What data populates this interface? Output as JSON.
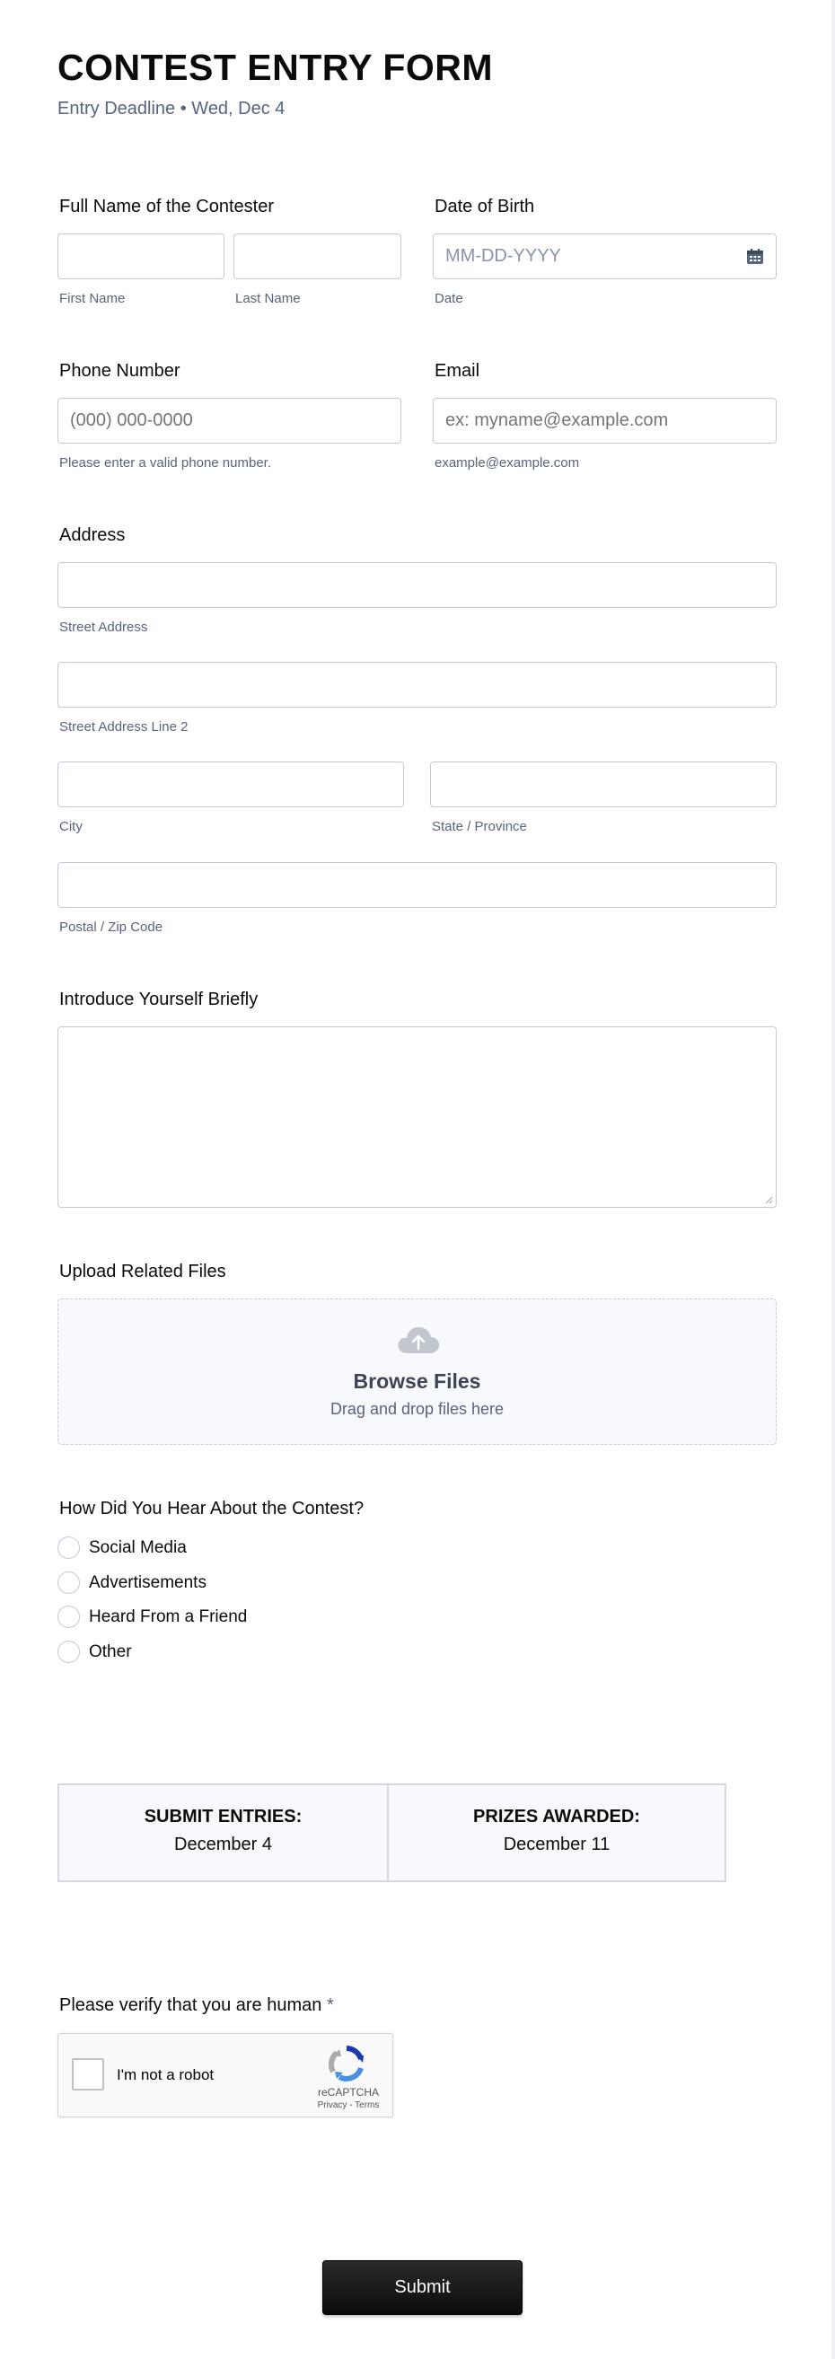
{
  "form": {
    "title": "CONTEST ENTRY FORM",
    "subtitle": "Entry Deadline • Wed, Dec 4"
  },
  "full_name": {
    "label": "Full Name of the Contester",
    "first_sublabel": "First Name",
    "last_sublabel": "Last Name",
    "first_value": "",
    "last_value": ""
  },
  "dob": {
    "label": "Date of Birth",
    "placeholder": "MM-DD-YYYY",
    "sublabel": "Date",
    "icon": "calendar-icon"
  },
  "phone": {
    "label": "Phone Number",
    "placeholder": "(000) 000-0000",
    "sublabel": "Please enter a valid phone number."
  },
  "email": {
    "label": "Email",
    "placeholder": "ex: myname@example.com",
    "sublabel": "example@example.com"
  },
  "address": {
    "label": "Address",
    "street_sublabel": "Street Address",
    "street2_sublabel": "Street Address Line 2",
    "city_sublabel": "City",
    "state_sublabel": "State / Province",
    "postal_sublabel": "Postal / Zip Code"
  },
  "intro": {
    "label": "Introduce Yourself Briefly"
  },
  "upload": {
    "label": "Upload Related Files",
    "browse": "Browse Files",
    "hint": "Drag and drop files here",
    "icon": "cloud-upload-icon"
  },
  "hear": {
    "label": "How Did You Hear About the Contest?",
    "options": [
      "Social Media",
      "Advertisements",
      "Heard From a Friend",
      "Other"
    ]
  },
  "dates": {
    "submit_head": "SUBMIT ENTRIES:",
    "submit_date": "December 4",
    "prizes_head": "PRIZES AWARDED:",
    "prizes_date": "December 11"
  },
  "captcha": {
    "label": "Please verify that you are human",
    "required_mark": "*",
    "checkbox_text": "I'm not a robot",
    "brand": "reCAPTCHA",
    "links": "Privacy - Terms"
  },
  "submit_label": "Submit",
  "colors": {
    "text": "#0b0b0b",
    "muted": "#57647e",
    "border": "#c3cad8",
    "upload_bg": "#f8f9fd",
    "button": "#111111"
  }
}
